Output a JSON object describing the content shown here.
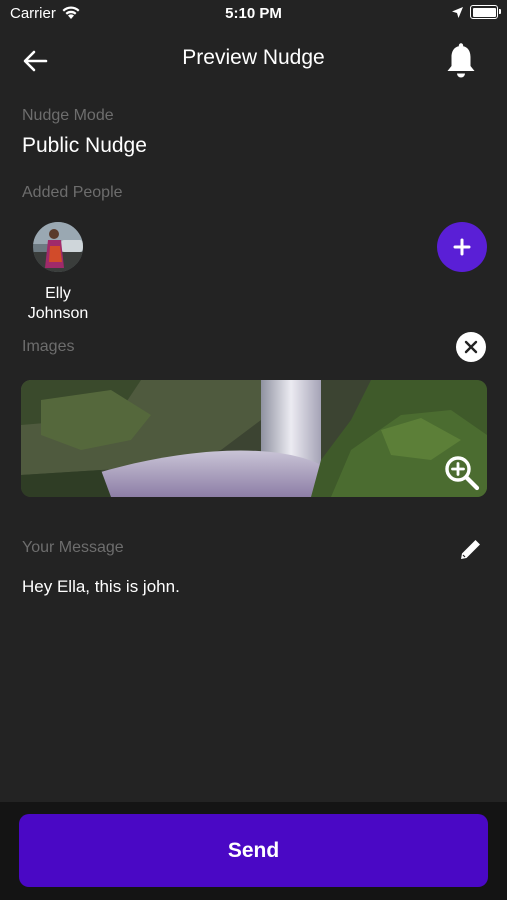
{
  "status_bar": {
    "carrier": "Carrier",
    "time": "5:10 PM",
    "icons": [
      "wifi-icon",
      "location-arrow-icon",
      "battery-icon"
    ]
  },
  "header": {
    "title": "Preview Nudge",
    "back_icon": "arrow-left-icon",
    "notification_icon": "bell-icon"
  },
  "nudge_mode": {
    "label": "Nudge Mode",
    "value": "Public Nudge"
  },
  "added_people": {
    "label": "Added People",
    "people": [
      {
        "name_line1": "Elly",
        "name_line2": "Johnson"
      }
    ],
    "add_icon": "plus-icon"
  },
  "images": {
    "label": "Images",
    "clear_icon": "close-icon",
    "zoom_icon": "zoom-in-icon"
  },
  "message": {
    "label": "Your Message",
    "text": "Hey Ella, this is john.",
    "edit_icon": "pencil-icon"
  },
  "footer": {
    "send_label": "Send"
  },
  "colors": {
    "background": "#232323",
    "accent": "#4a08c5",
    "add_button": "#5a1fd6",
    "muted_label": "#6d6d6d"
  }
}
